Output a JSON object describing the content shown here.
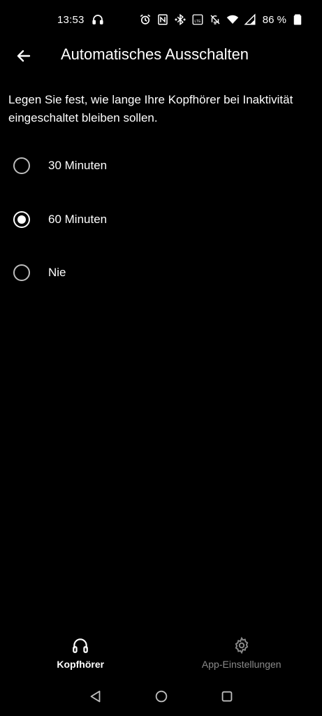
{
  "status_bar": {
    "time": "13:53",
    "battery_percent": "86 %",
    "icons": [
      "headphones-icon",
      "alarm-icon",
      "nfc-icon",
      "bluetooth-icon",
      "volte-icon",
      "mute-icon",
      "wifi-icon",
      "signal-icon",
      "battery-icon"
    ],
    "volte_text": "LTE"
  },
  "app_bar": {
    "title": "Automatisches Ausschalten",
    "back_icon": "arrow-left-icon"
  },
  "description": "Legen Sie fest, wie lange Ihre Kopfhörer bei Inaktivität eingeschaltet bleiben sollen.",
  "options": [
    {
      "label": "30 Minuten",
      "selected": false
    },
    {
      "label": "60 Minuten",
      "selected": true
    },
    {
      "label": "Nie",
      "selected": false
    }
  ],
  "bottom_nav": {
    "items": [
      {
        "label": "Kopfhörer",
        "icon": "headphones-icon",
        "active": true
      },
      {
        "label": "App-Einstellungen",
        "icon": "gear-icon",
        "active": false
      }
    ]
  },
  "system_nav": {
    "icons": [
      "back-triangle-icon",
      "home-circle-icon",
      "recents-square-icon"
    ]
  },
  "colors": {
    "background": "#000000",
    "text": "#ffffff",
    "inactive_text": "#8a8a8a",
    "radio_unchecked": "#bdbdbd"
  }
}
